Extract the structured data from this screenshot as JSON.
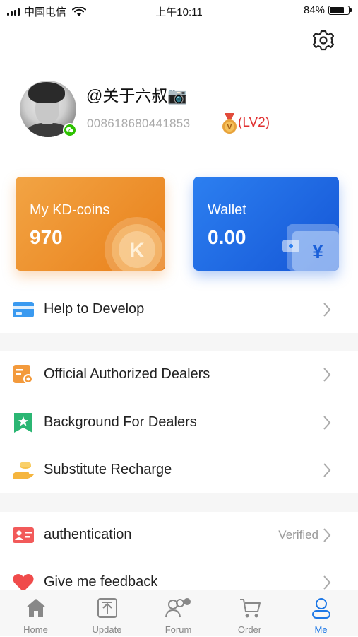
{
  "status_bar": {
    "carrier": "中国电信",
    "time": "上午10:11",
    "battery": "84%",
    "battery_level": 0.84
  },
  "profile": {
    "username": "@关于六叔📷",
    "user_id": "008618680441853",
    "level": "(LV2)"
  },
  "cards": {
    "coins": {
      "title": "My KD-coins",
      "value": "970",
      "badge": "K"
    },
    "wallet": {
      "title": "Wallet",
      "value": "0.00",
      "badge": "¥"
    }
  },
  "menu": {
    "help": {
      "label": "Help to Develop",
      "icon": "card-icon"
    },
    "dealers": {
      "label": "Official Authorized Dealers",
      "icon": "certificate-icon"
    },
    "background": {
      "label": "Background For Dealers",
      "icon": "bookmark-star-icon"
    },
    "recharge": {
      "label": "Substitute Recharge",
      "icon": "hand-coin-icon"
    },
    "authentication": {
      "label": "authentication",
      "status": "Verified",
      "icon": "id-card-icon"
    },
    "feedback": {
      "label": "Give me feedback",
      "icon": "heart-icon"
    }
  },
  "tabs": [
    {
      "label": "Home",
      "icon": "home-icon"
    },
    {
      "label": "Update",
      "icon": "upload-icon"
    },
    {
      "label": "Forum",
      "icon": "people-icon"
    },
    {
      "label": "Order",
      "icon": "cart-icon"
    },
    {
      "label": "Me",
      "icon": "person-icon"
    }
  ],
  "colors": {
    "accent": "#1e78e6",
    "coins_card": "#ec8a23",
    "wallet_card": "#1f6be3",
    "level_text": "#e02f2f"
  }
}
